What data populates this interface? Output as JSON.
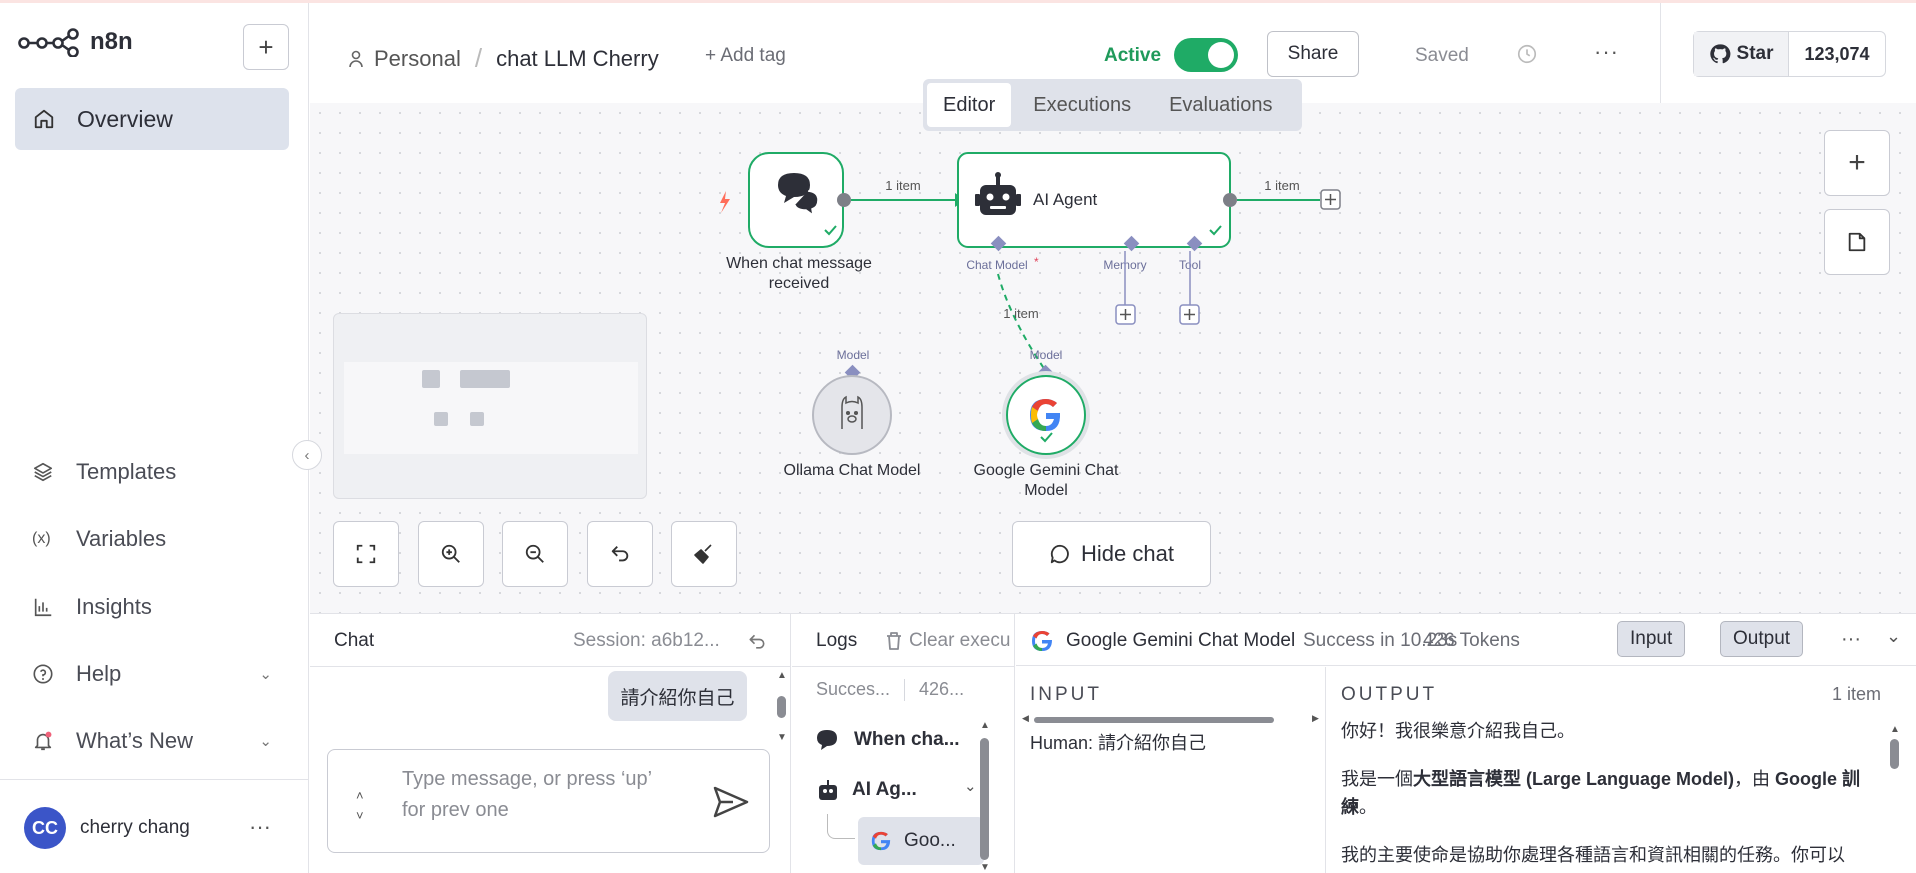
{
  "app": {
    "name": "n8n"
  },
  "sidebar": {
    "overview": "Overview",
    "items": [
      {
        "label": "Templates",
        "icon": "templates-icon"
      },
      {
        "label": "Variables",
        "icon": "variables-icon"
      },
      {
        "label": "Insights",
        "icon": "insights-icon"
      },
      {
        "label": "Help",
        "icon": "help-icon"
      },
      {
        "label": "What’s New",
        "icon": "bell-icon"
      }
    ],
    "user": {
      "initials": "CC",
      "name": "cherry chang"
    }
  },
  "header": {
    "project": "Personal",
    "workflow_name": "chat LLM Cherry",
    "add_tag": "+ Add tag",
    "active_label": "Active",
    "share_label": "Share",
    "saved_label": "Saved",
    "github_star": "Star",
    "github_count": "123,074"
  },
  "tabs": [
    {
      "label": "Editor",
      "active": true
    },
    {
      "label": "Executions",
      "active": false
    },
    {
      "label": "Evaluations",
      "active": false
    }
  ],
  "canvas": {
    "trigger_node": "When chat message received",
    "agent_node": "AI Agent",
    "agent_ports": {
      "chat_model": "Chat Model",
      "memory": "Memory",
      "tool": "Tool"
    },
    "ollama_node": "Ollama Chat Model",
    "gemini_node": "Google Gemini Chat Model",
    "model_port": "Model",
    "edge_label": "1 item",
    "hide_chat": "Hide chat"
  },
  "chat": {
    "title": "Chat",
    "session": "Session: a6b12...",
    "message": "請介紹你自己",
    "placeholder": "Type message, or press ‘up’ for prev one"
  },
  "logs": {
    "title": "Logs",
    "clear": "Clear execu",
    "status": "Succes...",
    "tokens": "426...",
    "rows": [
      {
        "label": "When cha..."
      },
      {
        "label": "AI Ag..."
      },
      {
        "label": "Goo..."
      }
    ]
  },
  "node_panel": {
    "title": "Google Gemini Chat Model",
    "success": "Success in 10.23s",
    "tokens": "426 Tokens",
    "input_btn": "Input",
    "output_btn": "Output",
    "input_label": "INPUT",
    "output_label": "OUTPUT",
    "item_count": "1 item",
    "input_text": "Human: 請介紹你自己",
    "output_p1": "你好！我很樂意介紹我自己。",
    "output_p2a": "我是一個",
    "output_p2b": "大型語言模型 (Large Language Model)",
    "output_p2c": "，由 ",
    "output_p2d": "Google 訓練",
    "output_p2e": "。",
    "output_p3": "我的主要使命是協助你處理各種語言和資訊相關的任務。你可以"
  },
  "colors": {
    "accent_green": "#1fab66",
    "nav_active": "#dde2ec",
    "avatar": "#3b55c8"
  }
}
